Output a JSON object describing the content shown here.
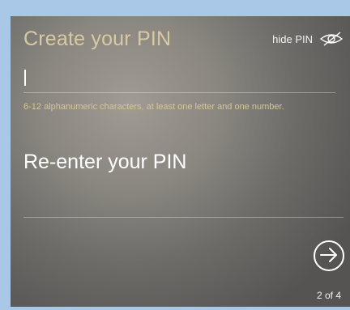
{
  "header": {
    "title": "Create your PIN",
    "hide_pin_label": "hide PIN",
    "hide_pin_icon": "eye-slash-icon"
  },
  "pin_field": {
    "value": "",
    "hint": "6-12 alphanumeric characters, at least one letter and one number."
  },
  "reenter": {
    "label": "Re-enter your PIN",
    "value": ""
  },
  "footer": {
    "next_icon": "arrow-right-icon",
    "step": "2 of 4"
  },
  "colors": {
    "title_accent": "#d9c9a3",
    "hint_text": "#d8c595",
    "frame_border": "#a9c7e6"
  }
}
